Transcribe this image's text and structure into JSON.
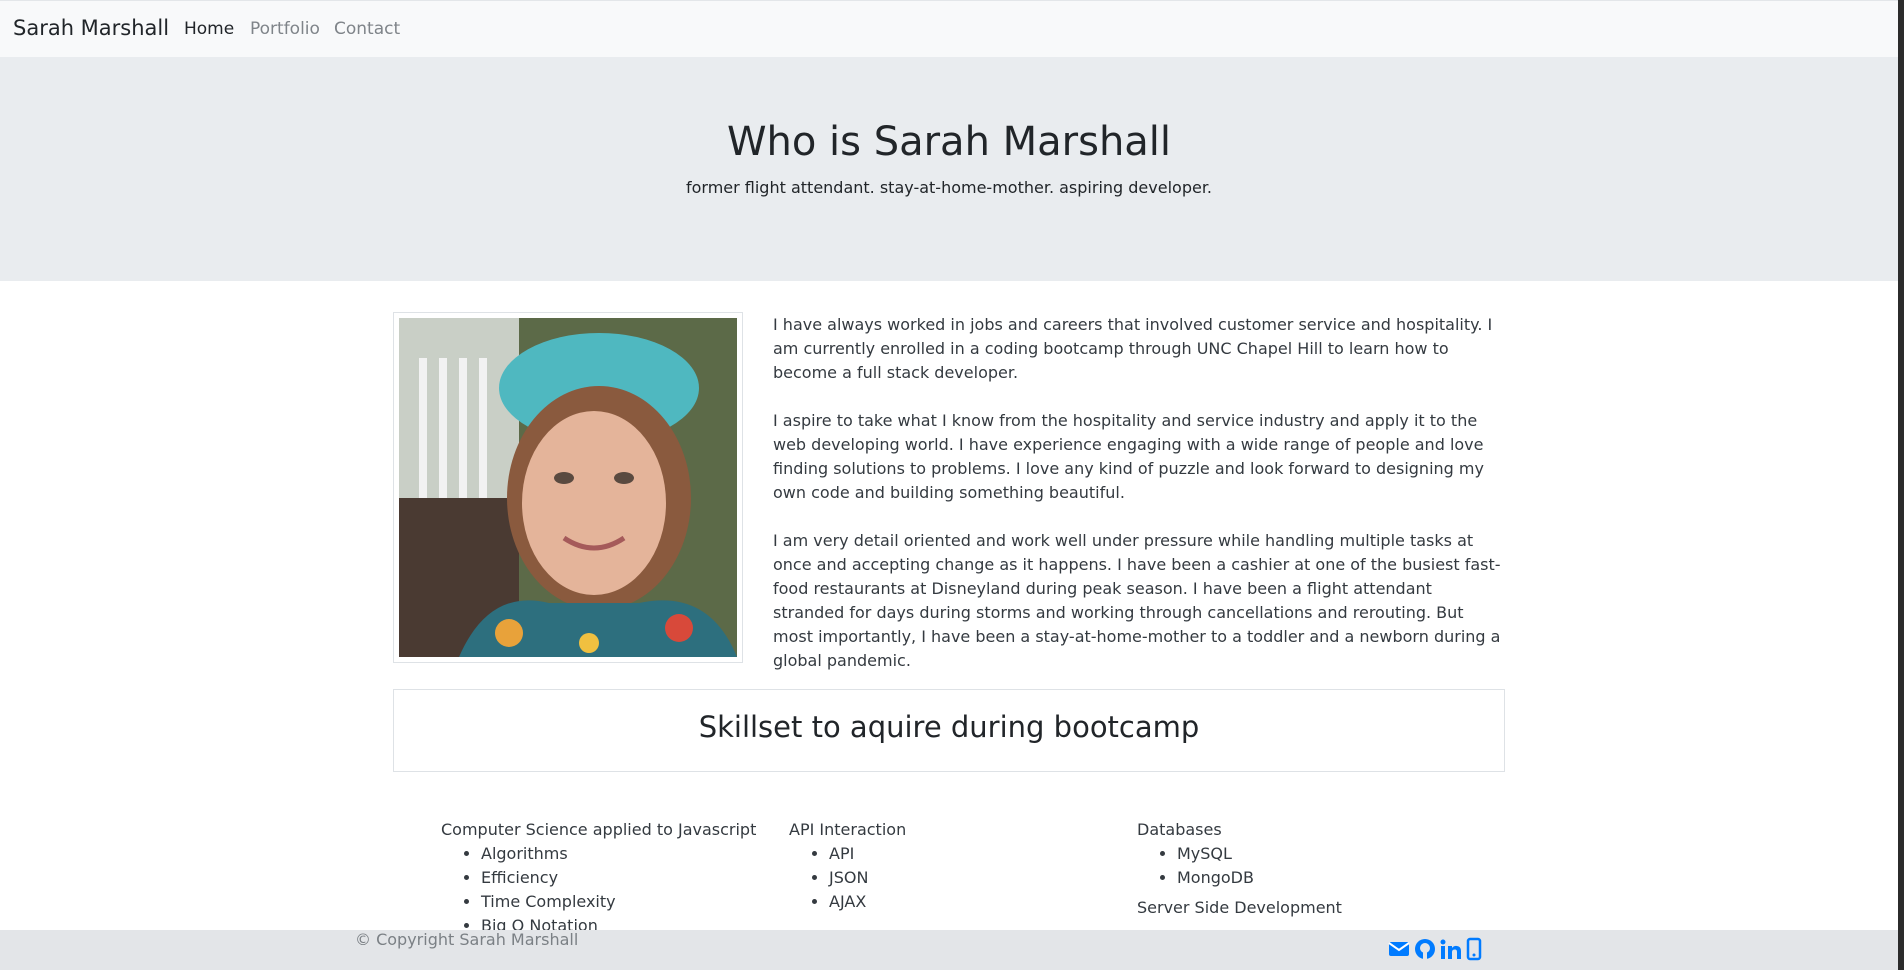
{
  "navbar": {
    "brand": "Sarah Marshall",
    "links": [
      {
        "label": "Home",
        "active": true
      },
      {
        "label": "Portfolio",
        "active": false
      },
      {
        "label": "Contact",
        "active": false
      }
    ]
  },
  "jumbotron": {
    "title": "Who is Sarah Marshall",
    "subtitle": "former flight attendant. stay-at-home-mother. aspiring developer."
  },
  "about": {
    "paragraphs": [
      "I have always worked in jobs and careers that involved customer service and hospitality. I am currently enrolled in a coding bootcamp through UNC Chapel Hill to learn how to become a full stack developer.",
      "I aspire to take what I know from the hospitality and service industry and apply it to the web developing world. I have experience engaging with a wide range of people and love finding solutions to problems. I love any kind of puzzle and look forward to designing my own code and building something beautiful.",
      "I am very detail oriented and work well under pressure while handling multiple tasks at once and accepting change as it happens. I have been a cashier at one of the busiest fast-food restaurants at Disneyland during peak season. I have been a flight attendant stranded for days during storms and working through cancellations and rerouting. But most importantly, I have been a stay-at-home-mother to a toddler and a newborn during a global pandemic."
    ]
  },
  "skills": {
    "heading": "Skillset to aquire during bootcamp",
    "columns": [
      {
        "title": "Computer Science applied to Javascript",
        "items": [
          "Algorithms",
          "Efficiency",
          "Time Complexity",
          "Big O Notation"
        ]
      },
      {
        "title": "API Interaction",
        "items": [
          "API",
          "JSON",
          "AJAX"
        ]
      },
      {
        "title": "Databases",
        "items": [
          "MySQL",
          "MongoDB"
        ]
      },
      {
        "title": "Server Side Development",
        "items": []
      }
    ]
  },
  "footer": {
    "copyright": "© Copyright Sarah Marshall",
    "icons": [
      "envelope-icon",
      "github-icon",
      "linkedin-icon",
      "mobile-phone-icon"
    ]
  },
  "colors": {
    "accent": "#007bff",
    "navbar_bg": "#f8f9fa",
    "jumbotron_bg": "#e9ecef",
    "footer_bg": "#e3e5e8"
  }
}
